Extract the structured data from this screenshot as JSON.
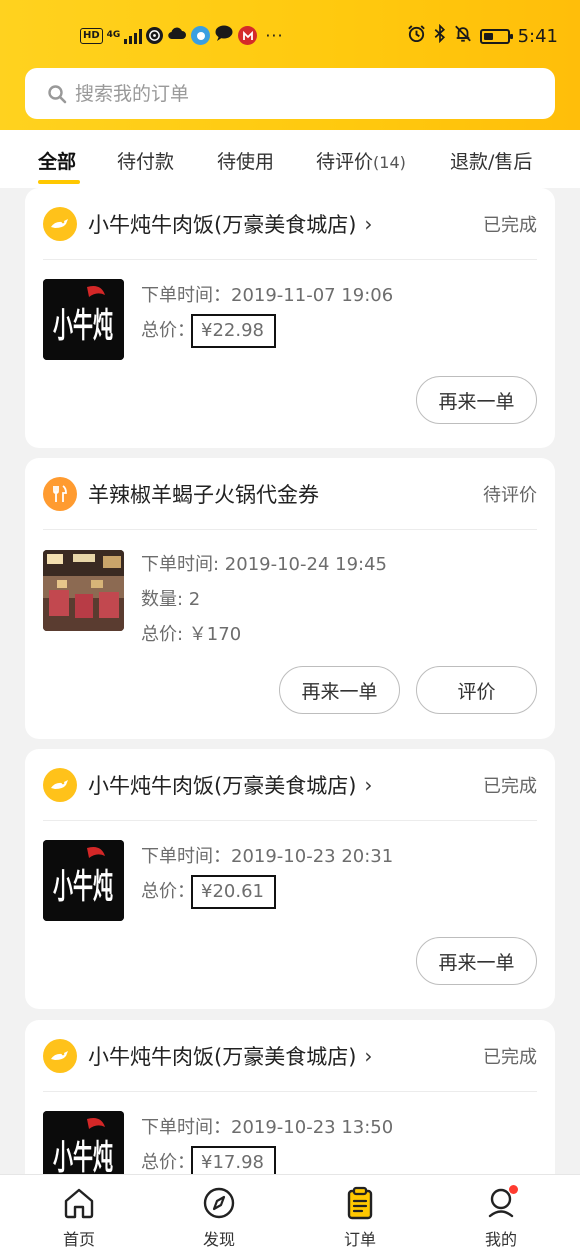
{
  "status_bar": {
    "hd": "HD",
    "network": "4G",
    "time": "5:41",
    "dots": "···"
  },
  "search": {
    "placeholder": "搜索我的订单"
  },
  "tabs": [
    {
      "label": "全部",
      "count": "",
      "active": true
    },
    {
      "label": "待付款",
      "count": ""
    },
    {
      "label": "待使用",
      "count": ""
    },
    {
      "label": "待评价",
      "count": "(14)"
    },
    {
      "label": "退款/售后",
      "count": ""
    }
  ],
  "orders": [
    {
      "shop": "小牛炖牛肉饭(万豪美食城店)",
      "has_chevron": true,
      "status": "已完成",
      "icon": "delivery-icon",
      "thumb": "xiaoniu-logo",
      "time_label": "下单时间：",
      "time": "2019-11-07 19:06",
      "price_label": "总价：",
      "price": "¥22.98",
      "buttons": [
        "再来一单"
      ]
    },
    {
      "shop": "羊辣椒羊蝎子火锅代金券",
      "has_chevron": false,
      "status": "待评价",
      "icon": "food-icon",
      "thumb": "restaurant-photo",
      "time_label": "下单时间: ",
      "time": "2019-10-24 19:45",
      "qty_label": "数量: ",
      "qty": "2",
      "price_label": "总价: ",
      "price": "￥170",
      "buttons": [
        "再来一单",
        "评价"
      ]
    },
    {
      "shop": "小牛炖牛肉饭(万豪美食城店)",
      "has_chevron": true,
      "status": "已完成",
      "icon": "delivery-icon",
      "thumb": "xiaoniu-logo",
      "time_label": "下单时间：",
      "time": "2019-10-23 20:31",
      "price_label": "总价：",
      "price": "¥20.61",
      "buttons": [
        "再来一单"
      ]
    },
    {
      "shop": "小牛炖牛肉饭(万豪美食城店)",
      "has_chevron": true,
      "status": "已完成",
      "icon": "delivery-icon",
      "thumb": "xiaoniu-logo",
      "time_label": "下单时间：",
      "time": "2019-10-23 13:50",
      "price_label": "总价：",
      "price": "¥17.98",
      "buttons": []
    }
  ],
  "logo_text": "小牛炖",
  "chevron": "›",
  "bottom_nav": [
    {
      "label": "首页",
      "icon": "home-icon"
    },
    {
      "label": "发现",
      "icon": "compass-icon"
    },
    {
      "label": "订单",
      "icon": "orders-icon",
      "active": true
    },
    {
      "label": "我的",
      "icon": "profile-icon",
      "badge": true
    }
  ],
  "colors": {
    "brand": "#ffc800",
    "badge": "#ff3b30"
  }
}
